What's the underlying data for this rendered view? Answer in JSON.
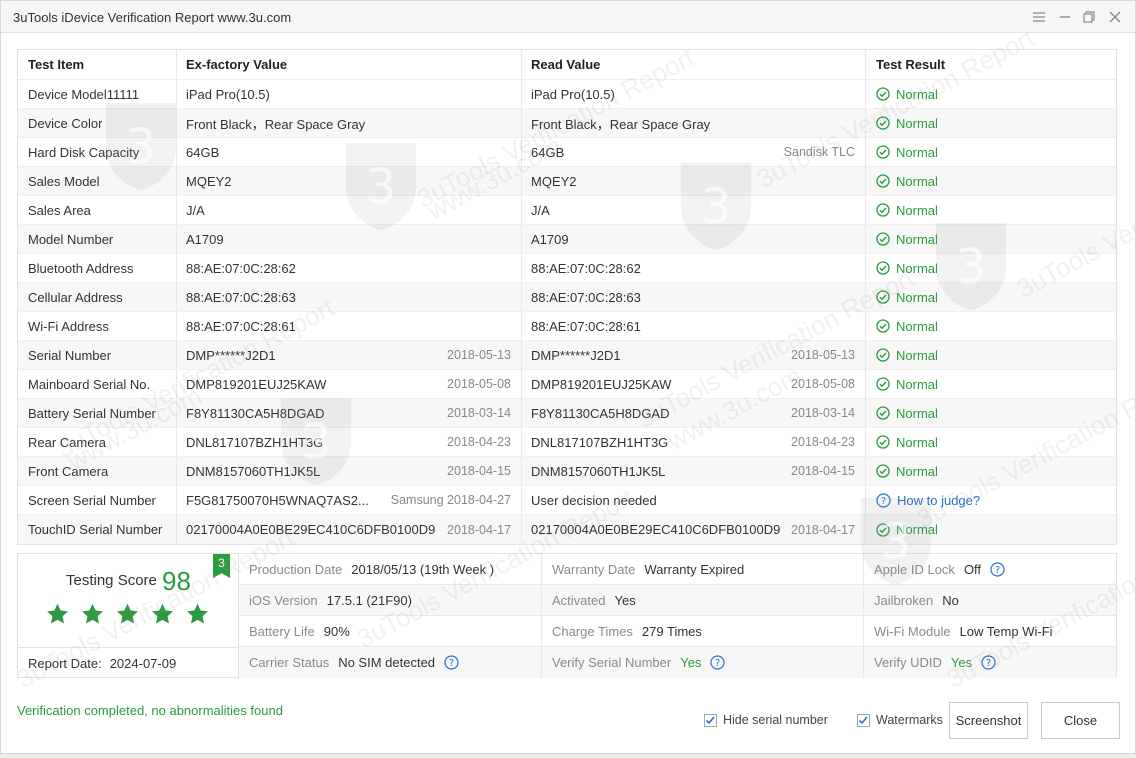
{
  "window": {
    "title": "3uTools iDevice Verification Report www.3u.com"
  },
  "watermark": {
    "text1": "3uTools Verification Report",
    "text2": "www.3u.com",
    "logo_char": "3"
  },
  "table": {
    "headers": [
      "Test Item",
      "Ex-factory Value",
      "Read Value",
      "Test Result"
    ],
    "rows": [
      {
        "item": "Device Model11111",
        "factory": "iPad Pro(10.5)",
        "factory_sub": "",
        "read": "iPad Pro(10.5)",
        "read_sub": "",
        "result": "Normal",
        "result_type": "ok"
      },
      {
        "item": "Device Color",
        "factory": "Front Black，Rear Space Gray",
        "factory_sub": "",
        "read": "Front Black，Rear Space Gray",
        "read_sub": "",
        "result": "Normal",
        "result_type": "ok"
      },
      {
        "item": "Hard Disk Capacity",
        "factory": "64GB",
        "factory_sub": "",
        "read": "64GB",
        "read_sub": "Sandisk TLC",
        "result": "Normal",
        "result_type": "ok"
      },
      {
        "item": "Sales Model",
        "factory": "MQEY2",
        "factory_sub": "",
        "read": "MQEY2",
        "read_sub": "",
        "result": "Normal",
        "result_type": "ok"
      },
      {
        "item": "Sales Area",
        "factory": "J/A",
        "factory_sub": "",
        "read": "J/A",
        "read_sub": "",
        "result": "Normal",
        "result_type": "ok"
      },
      {
        "item": "Model Number",
        "factory": "A1709",
        "factory_sub": "",
        "read": "A1709",
        "read_sub": "",
        "result": "Normal",
        "result_type": "ok"
      },
      {
        "item": "Bluetooth Address",
        "factory": "88:AE:07:0C:28:62",
        "factory_sub": "",
        "read": "88:AE:07:0C:28:62",
        "read_sub": "",
        "result": "Normal",
        "result_type": "ok"
      },
      {
        "item": "Cellular Address",
        "factory": "88:AE:07:0C:28:63",
        "factory_sub": "",
        "read": "88:AE:07:0C:28:63",
        "read_sub": "",
        "result": "Normal",
        "result_type": "ok"
      },
      {
        "item": "Wi-Fi Address",
        "factory": "88:AE:07:0C:28:61",
        "factory_sub": "",
        "read": "88:AE:07:0C:28:61",
        "read_sub": "",
        "result": "Normal",
        "result_type": "ok"
      },
      {
        "item": "Serial Number",
        "factory": "DMP******J2D1",
        "factory_sub": "2018-05-13",
        "read": "DMP******J2D1",
        "read_sub": "2018-05-13",
        "result": "Normal",
        "result_type": "ok"
      },
      {
        "item": "Mainboard Serial No.",
        "factory": "DMP819201EUJ25KAW",
        "factory_sub": "2018-05-08",
        "read": "DMP819201EUJ25KAW",
        "read_sub": "2018-05-08",
        "result": "Normal",
        "result_type": "ok"
      },
      {
        "item": "Battery Serial Number",
        "factory": "F8Y81130CA5H8DGAD",
        "factory_sub": "2018-03-14",
        "read": "F8Y81130CA5H8DGAD",
        "read_sub": "2018-03-14",
        "result": "Normal",
        "result_type": "ok"
      },
      {
        "item": "Rear Camera",
        "factory": "DNL817107BZH1HT3G",
        "factory_sub": "2018-04-23",
        "read": "DNL817107BZH1HT3G",
        "read_sub": "2018-04-23",
        "result": "Normal",
        "result_type": "ok"
      },
      {
        "item": "Front Camera",
        "factory": "DNM8157060TH1JK5L",
        "factory_sub": "2018-04-15",
        "read": "DNM8157060TH1JK5L",
        "read_sub": "2018-04-15",
        "result": "Normal",
        "result_type": "ok"
      },
      {
        "item": "Screen Serial Number",
        "factory": "F5G81750070H5WNAQ7AS2...",
        "factory_sub": "Samsung 2018-04-27",
        "read": "User decision needed",
        "read_sub": "",
        "result": "How to judge?",
        "result_type": "judge"
      },
      {
        "item": "TouchID Serial Number",
        "factory": "02170004A0E0BE29EC410C6DFB0100D9",
        "factory_sub": "2018-04-17",
        "read": "02170004A0E0BE29EC410C6DFB0100D9",
        "read_sub": "2018-04-17",
        "result": "Normal",
        "result_type": "ok"
      }
    ]
  },
  "summary": {
    "score_label": "Testing Score",
    "score_value": "98",
    "badge": "3",
    "stars": 5,
    "report_date_label": "Report Date:",
    "report_date_value": "2024-07-09",
    "rows": [
      [
        {
          "label": "Production Date",
          "value": "2018/05/13 (19th Week )",
          "green": false,
          "help": false
        },
        {
          "label": "Warranty Date",
          "value": "Warranty Expired",
          "green": false,
          "help": false
        },
        {
          "label": "Apple ID Lock",
          "value": "Off",
          "green": false,
          "help": true
        }
      ],
      [
        {
          "label": "iOS Version",
          "value": "17.5.1 (21F90)",
          "green": false,
          "help": false
        },
        {
          "label": "Activated",
          "value": "Yes",
          "green": false,
          "help": false
        },
        {
          "label": "Jailbroken",
          "value": "No",
          "green": false,
          "help": false
        }
      ],
      [
        {
          "label": "Battery Life",
          "value": "90%",
          "green": false,
          "help": false
        },
        {
          "label": "Charge Times",
          "value": "279 Times",
          "green": false,
          "help": false
        },
        {
          "label": "Wi-Fi Module",
          "value": "Low Temp Wi-Fi",
          "green": false,
          "help": false
        }
      ],
      [
        {
          "label": "Carrier Status",
          "value": "No SIM detected",
          "green": false,
          "help": true
        },
        {
          "label": "Verify Serial Number",
          "value": "Yes",
          "green": true,
          "help": true
        },
        {
          "label": "Verify UDID",
          "value": "Yes",
          "green": true,
          "help": true
        }
      ]
    ]
  },
  "footer": {
    "status": "Verification completed, no abnormalities found",
    "hide_serial_label": "Hide serial number",
    "hide_serial_checked": true,
    "watermarks_label": "Watermarks",
    "watermarks_checked": true,
    "screenshot_label": "Screenshot",
    "close_label": "Close"
  },
  "colors": {
    "green": "#2c9a3f",
    "link": "#2a6fc9"
  },
  "icons": {
    "check": "check-circle-icon",
    "help": "question-circle-icon",
    "star": "star-icon",
    "menu": "menu-icon",
    "minimize": "minimize-icon",
    "maximize": "maximize-icon",
    "close": "close-icon"
  }
}
